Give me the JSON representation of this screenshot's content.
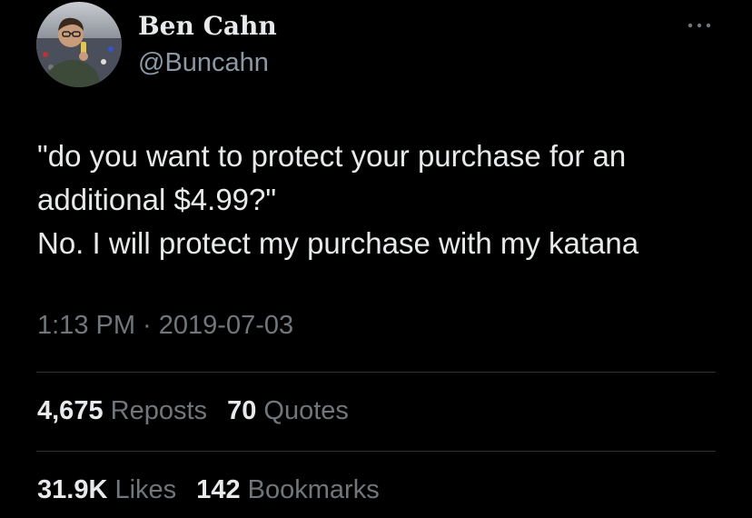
{
  "author": {
    "display_name": "Ben Cahn",
    "handle": "@Buncahn",
    "avatar_icon": "user-avatar-photo"
  },
  "more_icon": "more-horizontal-icon",
  "tweet": {
    "lines": [
      "\"do you want to protect your purchase for an additional $4.99?\"",
      "No. I will protect my purchase with my katana"
    ],
    "timestamp": "1:13 PM · 2019-07-03"
  },
  "stats": {
    "reposts": {
      "count": "4,675",
      "label": "Reposts"
    },
    "quotes": {
      "count": "70",
      "label": "Quotes"
    },
    "likes": {
      "count": "31.9K",
      "label": "Likes"
    },
    "bookmarks": {
      "count": "142",
      "label": "Bookmarks"
    }
  },
  "colors": {
    "background": "#000000",
    "primary_text": "#e7e9ea",
    "secondary_text": "#71767b",
    "divider": "#2f3336"
  }
}
